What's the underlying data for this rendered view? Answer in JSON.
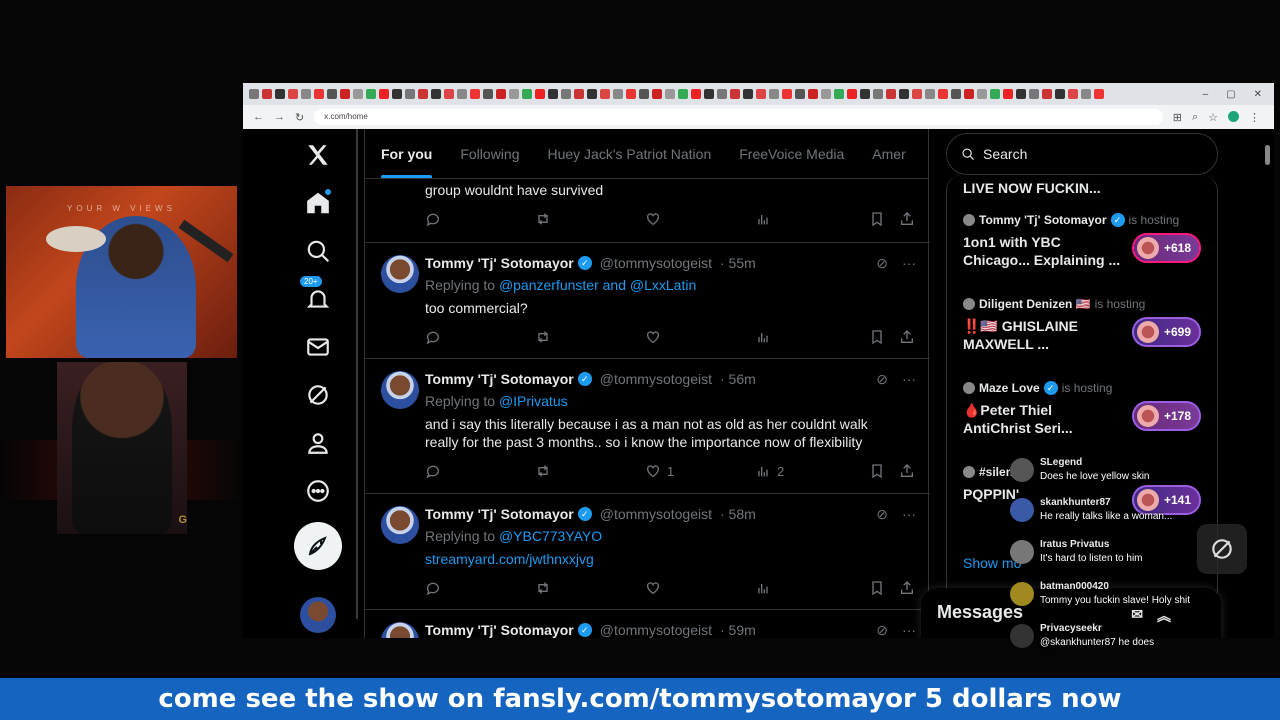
{
  "overlay": {
    "banner_text": "come see the show on fansly.com/tommysotomayor 5 dollars now",
    "cam1_banner": "YOUR W        VIEWS",
    "cam2_letter": "G"
  },
  "browser": {
    "url": "x.com/home",
    "new_tab": "+",
    "close_tab": "×"
  },
  "nav": {
    "notif_count": "20+"
  },
  "timeline": {
    "tabs": [
      "For you",
      "Following",
      "Huey Jack's Patriot Nation",
      "FreeVoice Media",
      "Amer"
    ],
    "top_fragment": "group wouldnt have survived",
    "posts": [
      {
        "name": "Tommy 'Tj' Sotomayor",
        "handle": "@tommysotogeist",
        "time": "· 55m",
        "reply_prefix": "Replying to ",
        "reply_to": "@panzerfunster and @LxxLatin",
        "text": "too commercial?",
        "likes": "",
        "views": ""
      },
      {
        "name": "Tommy 'Tj' Sotomayor",
        "handle": "@tommysotogeist",
        "time": "· 56m",
        "reply_prefix": "Replying to ",
        "reply_to": "@IPrivatus",
        "text": "and i say this literally because i as a man not as old as her couldnt walk really for the past 3 months.. so i know the importance now of flexibility",
        "likes": "1",
        "views": "2"
      },
      {
        "name": "Tommy 'Tj' Sotomayor",
        "handle": "@tommysotogeist",
        "time": "· 58m",
        "reply_prefix": "Replying to ",
        "reply_to": "@YBC773YAYO",
        "text": "streamyard.com/jwthnxxjvg",
        "likes": "",
        "views": ""
      },
      {
        "name": "Tommy 'Tj' Sotomayor",
        "handle": "@tommysotogeist",
        "time": "· 59m"
      }
    ]
  },
  "sidebar": {
    "search_placeholder": "Search",
    "top_fragment": "LIVE NOW FUCKIN...",
    "spaces": [
      {
        "host": "Tommy 'Tj' Sotomayor",
        "status": "is hosting",
        "title": "1on1 with YBC Chicago... Explaining ...",
        "count": "+618"
      },
      {
        "host": "Diligent Denizen 🇺🇸",
        "status": "is hosting",
        "title": "‼️🇺🇸 GHISLAINE MAXWELL ...",
        "count": "+699"
      },
      {
        "host": "Maze Love",
        "status": "is hosting",
        "title": "🩸Peter Thiel AntiChrist Seri...",
        "count": "+178"
      },
      {
        "host": "#silen",
        "status": "",
        "title": "PQPPIN'",
        "count": "+141"
      }
    ],
    "show_more": "Show mo",
    "messages_label": "Messages"
  },
  "chat": [
    {
      "user": "SLegend",
      "text": "Does he love yellow skin"
    },
    {
      "user": "skankhunter87",
      "text": "He really talks like a woman..."
    },
    {
      "user": "Iratus Privatus",
      "text": "It's hard to listen to him"
    },
    {
      "user": "batman000420",
      "text": "Tommy you fuckin slave! Holy shit"
    },
    {
      "user": "Privacyseekr",
      "text": "@skankhunter87 he does"
    }
  ],
  "colors": {
    "accent": "#1d9bf0",
    "banner_bg": "#1565c0",
    "space_ring": "#f91880"
  }
}
